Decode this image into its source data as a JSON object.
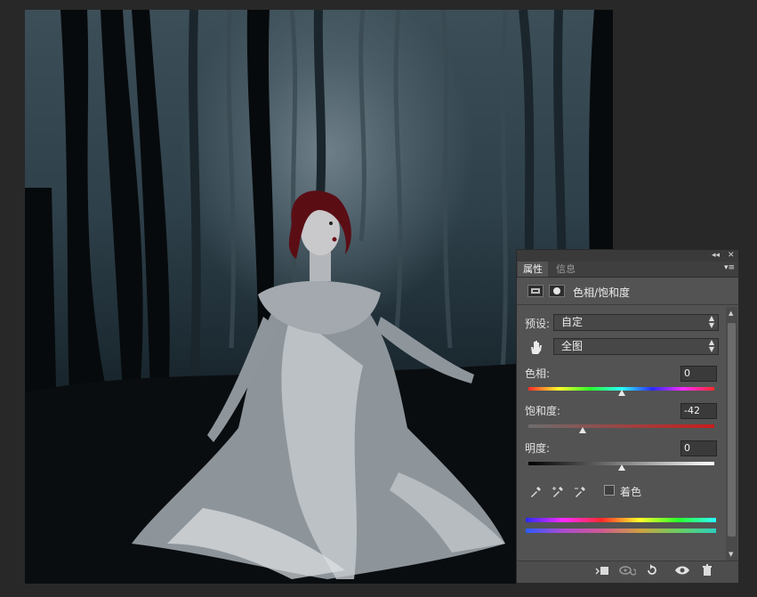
{
  "panel": {
    "tabs": [
      "属性",
      "信息"
    ],
    "title": "色相/饱和度",
    "preset_label": "预设:",
    "preset_value": "自定",
    "channel_value": "全图",
    "hue": {
      "label": "色相:",
      "value": "0",
      "level": 0.5
    },
    "saturation": {
      "label": "饱和度:",
      "value": "-42",
      "level": 0.29
    },
    "lightness": {
      "label": "明度:",
      "value": "0",
      "level": 0.5
    },
    "colorize_label": "着色",
    "colorize_checked": false
  },
  "icons": {
    "collapse": "double-chevron-left-icon",
    "close": "close-icon",
    "panel_menu": "panel-menu-icon",
    "adjustment": "adjustment-layer-icon",
    "mask": "layer-mask-icon",
    "hand": "targeted-adjustment-hand-icon",
    "eyedroppers": [
      "eyedropper-icon",
      "eyedropper-plus-icon",
      "eyedropper-minus-icon"
    ],
    "footer": [
      "clip-to-layer-icon",
      "view-previous-state-icon",
      "reset-icon",
      "visibility-eye-icon",
      "trash-icon"
    ]
  },
  "colors": {
    "app_background": "#282828",
    "panel_background": "#535353",
    "saturation_track": "#c81c1c"
  }
}
